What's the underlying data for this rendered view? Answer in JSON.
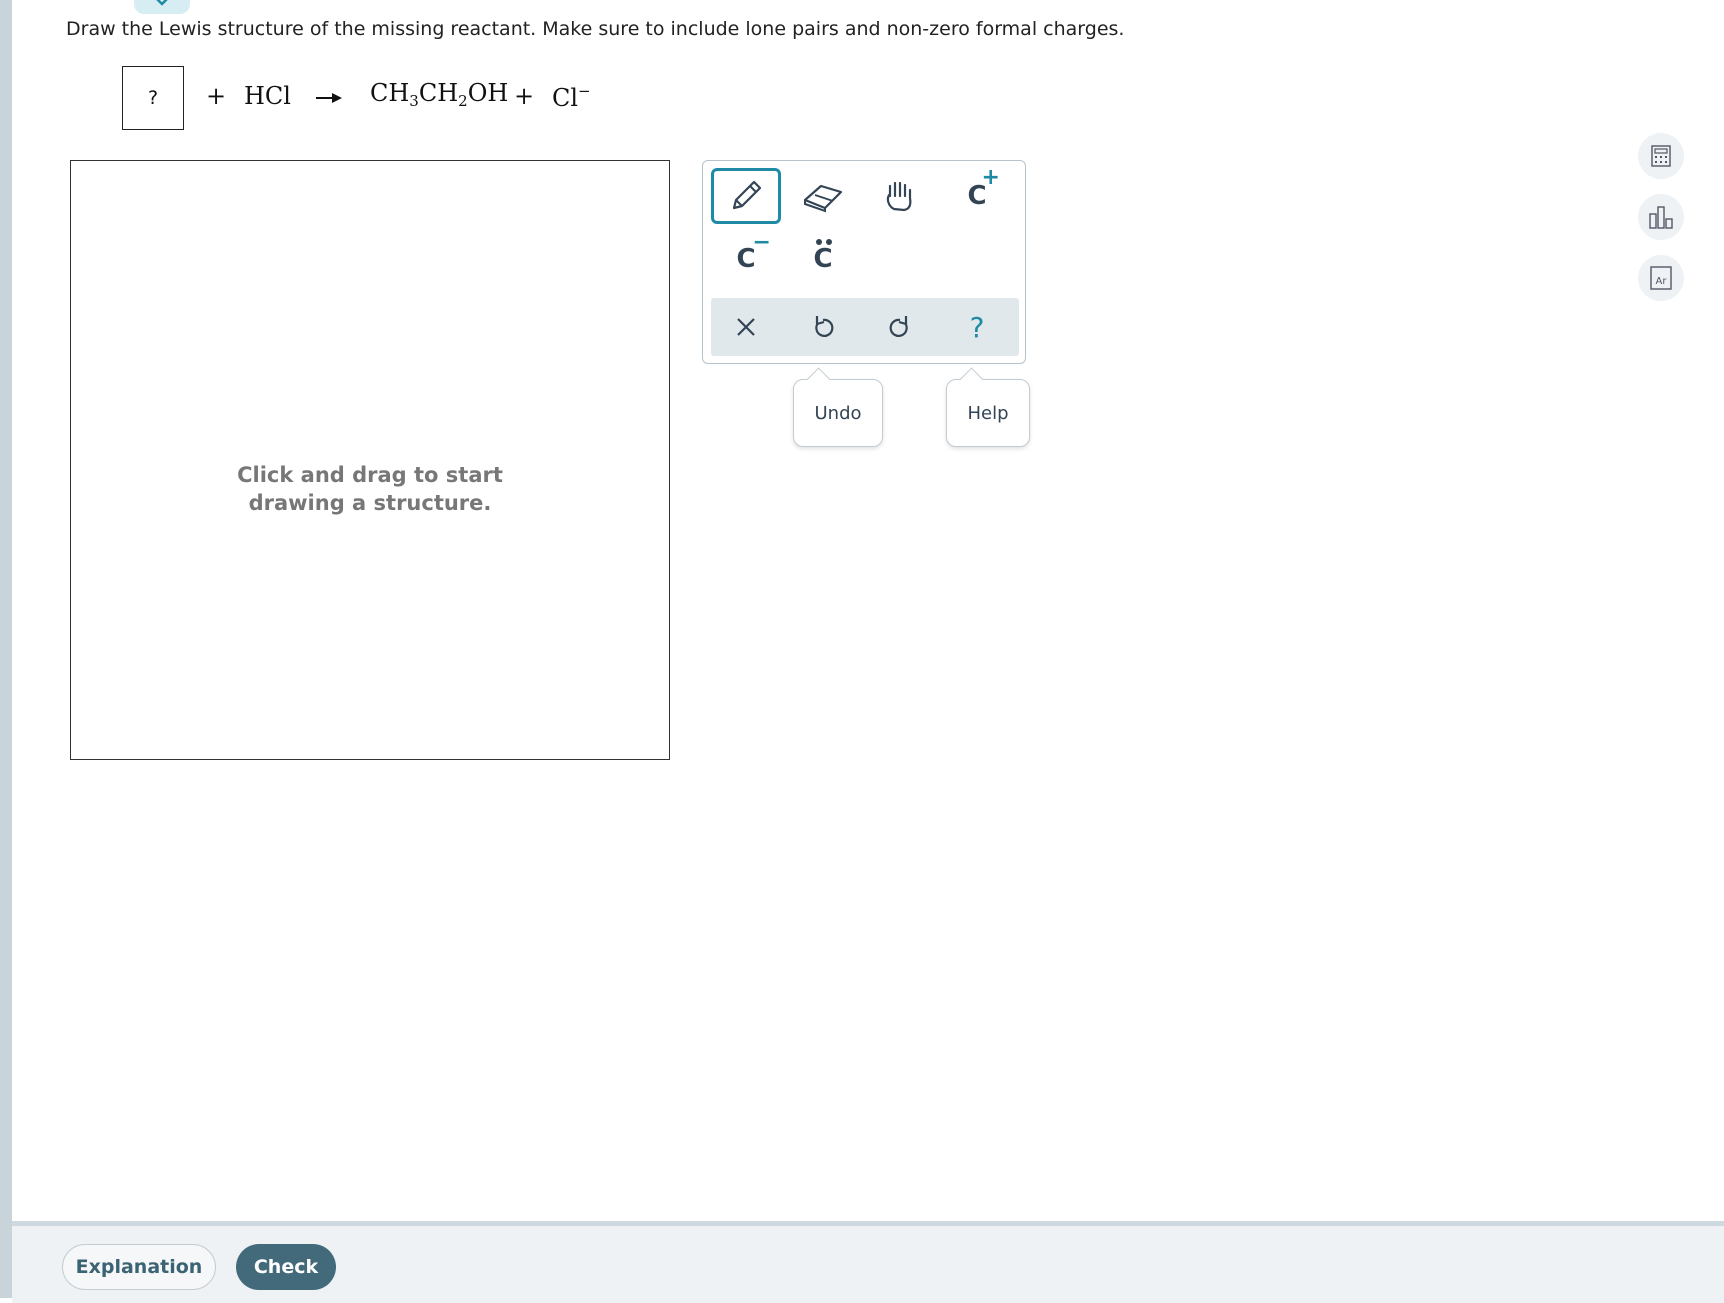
{
  "question": {
    "prompt": "Draw the Lewis structure of the missing reactant. Make sure to include lone pairs and non-zero formal charges."
  },
  "equation": {
    "unknown": "?",
    "plus1": "+",
    "reactant2": "HCl",
    "product1": {
      "p1": "CH",
      "s1": "3",
      "p2": "CH",
      "s2": "2",
      "p3": "OH"
    },
    "plus2": "+",
    "product2": {
      "base": "Cl",
      "charge": "−"
    }
  },
  "canvas": {
    "hint_line1": "Click and drag to start",
    "hint_line2": "drawing a structure."
  },
  "toolbar": {
    "tools": [
      "pencil-icon",
      "eraser-icon",
      "hand-icon",
      "add-positive-charge",
      "add-negative-charge",
      "add-lone-pair"
    ],
    "atom_label": "C",
    "plus_sign": "+",
    "minus_sign": "−",
    "actions": [
      "clear-icon",
      "undo-icon",
      "redo-icon",
      "help-icon"
    ],
    "help_glyph": "?",
    "accent_color": "#1e8aa6"
  },
  "tooltips": {
    "undo": "Undo",
    "help": "Help"
  },
  "side_tools": [
    "calculator-icon",
    "bar-chart-icon",
    "periodic-table-icon"
  ],
  "periodic_symbol": "Ar",
  "footer": {
    "explanation": "Explanation",
    "check": "Check"
  }
}
